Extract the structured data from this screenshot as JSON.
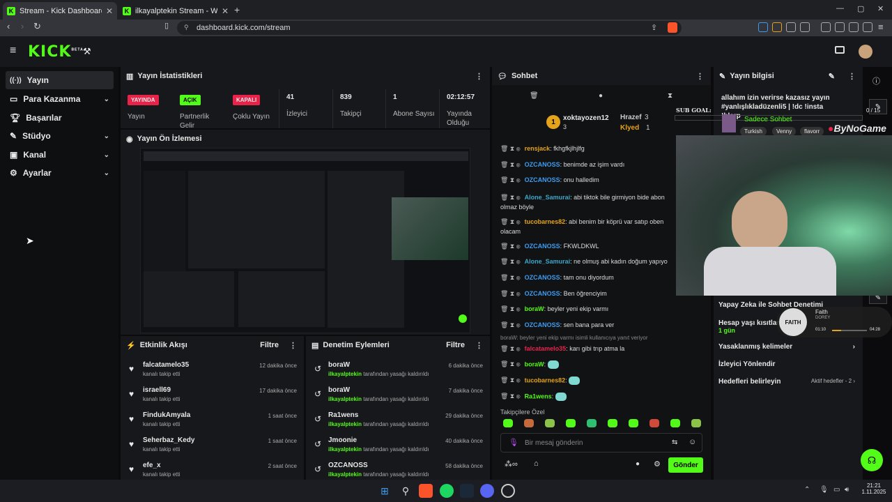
{
  "browser": {
    "tabs": [
      {
        "label": "Stream - Kick Dashboard",
        "active": true
      },
      {
        "label": "ilkayalptekin Stream - Watch Live",
        "active": false
      }
    ],
    "url": "dashboard.kick.com/stream"
  },
  "brand": {
    "logo": "KICK",
    "beta": "BETA",
    "accent": "#53fc18"
  },
  "sidebar": {
    "items": [
      {
        "label": "Yayın",
        "icon": "broadcast-icon",
        "active": true
      },
      {
        "label": "Para Kazanma",
        "icon": "money-icon",
        "chevron": true
      },
      {
        "label": "Başarılar",
        "icon": "trophy-icon"
      },
      {
        "label": "Stüdyo",
        "icon": "studio-icon",
        "chevron": true
      },
      {
        "label": "Kanal",
        "icon": "channel-icon",
        "chevron": true
      },
      {
        "label": "Ayarlar",
        "icon": "gear-icon",
        "chevron": true
      }
    ]
  },
  "stats": {
    "title": "Yayın İstatistikleri",
    "cols": [
      {
        "badge": "YAYINDA",
        "badge_color": "#e8234a",
        "label": "Yayın"
      },
      {
        "badge": "AÇIK",
        "badge_color": "#53fc18",
        "label": "Partnerlik Gelir"
      },
      {
        "badge": "KAPALI",
        "badge_color": "#e8234a",
        "label": "Çoklu Yayın"
      },
      {
        "value": "41",
        "label": "İzleyici"
      },
      {
        "value": "839",
        "label": "Takipçi"
      },
      {
        "value": "1",
        "label": "Abone Sayısı"
      },
      {
        "value": "02:12:57",
        "label": "Yayında Olduğu"
      }
    ]
  },
  "preview": {
    "title": "Yayın Ön İzlemesi"
  },
  "activity": {
    "title": "Etkinlik Akışı",
    "filter": "Filtre",
    "items": [
      {
        "name": "falcatamelo35",
        "sub": "kanalı takip etti",
        "time": "12 dakika önce"
      },
      {
        "name": "israell69",
        "sub": "kanalı takip etti",
        "time": "17 dakika önce"
      },
      {
        "name": "FindukAmyala",
        "sub": "kanalı takip etti",
        "time": "1 saat önce"
      },
      {
        "name": "Seherbaz_Kedy",
        "sub": "kanalı takip etti",
        "time": "1 saat önce"
      },
      {
        "name": "efe_x",
        "sub": "kanalı takip etti",
        "time": "2 saat önce"
      }
    ]
  },
  "moderation": {
    "title": "Denetim Eylemleri",
    "filter": "Filtre",
    "by": "ilkayalptekin",
    "action": "tarafından yasağı kaldırıldı",
    "items": [
      {
        "name": "boraW",
        "time": "6 dakika önce"
      },
      {
        "name": "boraW",
        "time": "7 dakika önce"
      },
      {
        "name": "Ra1wens",
        "time": "29 dakika önce"
      },
      {
        "name": "Jmoonie",
        "time": "40 dakika önce"
      },
      {
        "name": "OZCANOSS",
        "time": "58 dakika önce"
      }
    ]
  },
  "chat": {
    "title": "Sohbet",
    "top": {
      "leader": "xoktayozen12",
      "leader_count": "3",
      "second": "Hrazef",
      "second_count": "3",
      "third": "Klyed",
      "third_count": "1",
      "rank": "1"
    },
    "messages": [
      {
        "user": "rensjack",
        "color": "#e5a31b",
        "text": "fkhgfkjlhjlfg"
      },
      {
        "user": "OZCANOSS",
        "color": "#3d9cf0",
        "text": "benimde az işim vardı"
      },
      {
        "user": "OZCANOSS",
        "color": "#3d9cf0",
        "text": "onu halledim"
      },
      {
        "user": "Alone_Samurai",
        "color": "#3ba6c9",
        "text": "abi tiktok bile girmiyon bide abon olmaz böyle"
      },
      {
        "user": "tucobarnes82",
        "color": "#e5a31b",
        "text": "abi benim bir köprü var satıp oben olacam"
      },
      {
        "user": "OZCANOSS",
        "color": "#3d9cf0",
        "text": "FKWLDKWL"
      },
      {
        "user": "Alone_Samurai",
        "color": "#3ba6c9",
        "text": "ne olmuş abi kadın doğum yapıyo"
      },
      {
        "user": "OZCANOSS",
        "color": "#3d9cf0",
        "text": "tam onu diyordum"
      },
      {
        "user": "OZCANOSS",
        "color": "#3d9cf0",
        "text": "Ben öğrenciyim"
      },
      {
        "user": "boraW",
        "color": "#53fc18",
        "text": "beyler yeni ekip varmı"
      },
      {
        "user": "OZCANOSS",
        "color": "#3d9cf0",
        "text": "sen bana para ver"
      },
      {
        "user": "falcatamelo35",
        "color": "#e8234a",
        "text": "karı gibi trıp atma la"
      },
      {
        "user": "boraW",
        "color": "#53fc18",
        "text": ""
      },
      {
        "user": "tucobarnes82",
        "color": "#e5a31b",
        "text": ""
      },
      {
        "user": "Ra1wens",
        "color": "#53fc18",
        "text": ""
      }
    ],
    "reply_note": "boraW: beyler yeni ekip varmı isimli kullanıcıya yanıt veriyor",
    "emote_section": "Takipçilere Özel",
    "input_placeholder": "Bir mesaj gönderin",
    "send": "Gönder"
  },
  "info": {
    "title": "Yayın bilgisi",
    "stream_title": "allahım izin verirse kazasız yayın #yanlışlıkladüzenli5 | !dc !insta !blerp",
    "rows": [
      {
        "label": "Yapay Zeka ile Sohbet Denetimi",
        "right": ""
      },
      {
        "label": "Hesap yaşı kısıtlaması",
        "right": "",
        "sub": "1 gün"
      },
      {
        "label": "Yasaklanmış kelimeler",
        "right": "›"
      },
      {
        "label": "İzleyici Yönlendir",
        "right": ""
      },
      {
        "label": "Hedefleri belirleyin",
        "right": "Aktif hedefler - 2 ›"
      }
    ]
  },
  "overlay": {
    "sub_goal": "SUB GOAL:",
    "sub_goal_count": "0 / 15",
    "sub_only": "Sadece Sohbet",
    "tags": [
      "Turkish",
      "Venny",
      "flavorr"
    ],
    "brand": "ByNoGame",
    "music": {
      "track": "Faith",
      "artist": "DOREY",
      "elapsed": "01:10",
      "total": "04:28",
      "progress": 0.26
    }
  },
  "taskbar": {
    "time": "21:21",
    "date": "1.11.2025"
  }
}
